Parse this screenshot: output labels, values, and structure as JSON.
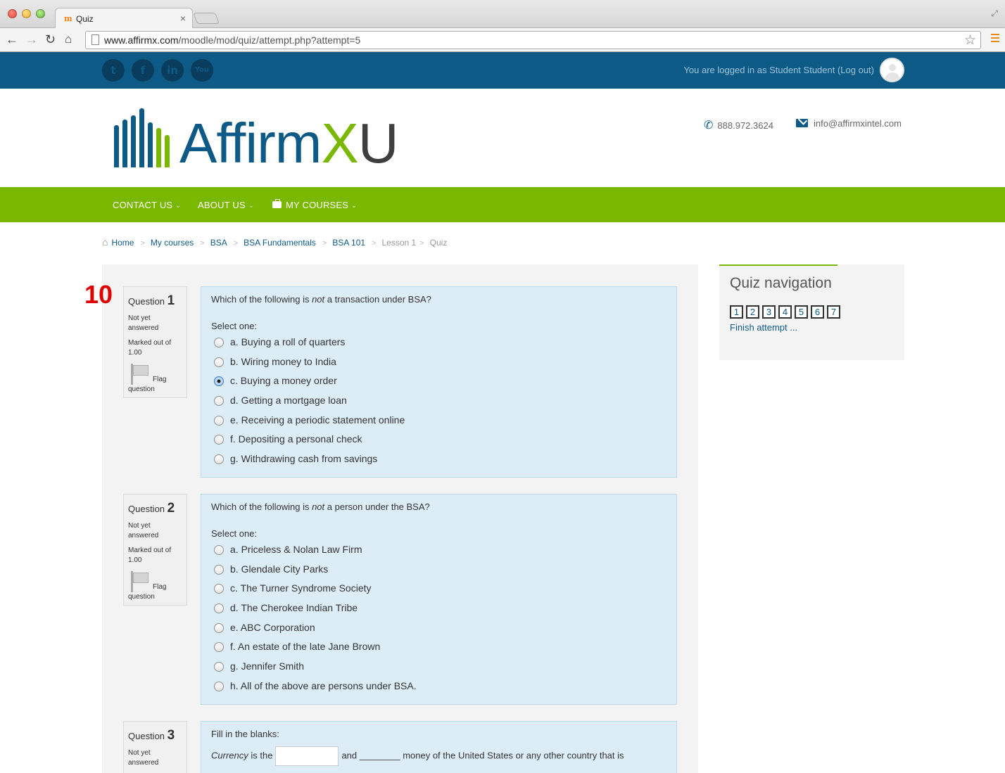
{
  "browser": {
    "tab_title": "Quiz",
    "tab_favicon": "m",
    "url_host": "www.affirmx.com",
    "url_path": "/moodle/mod/quiz/attempt.php?attempt=5"
  },
  "topbar": {
    "social_icons": [
      "twitter-icon",
      "facebook-icon",
      "linkedin-icon",
      "youtube-icon"
    ],
    "social_glyphs": [
      "t",
      "f",
      "in",
      "You"
    ],
    "login_text": "You are logged in as Student Student (Log out)"
  },
  "logo": {
    "part_affirm": "Affirm",
    "part_x": "X",
    "part_u": "U"
  },
  "contact": {
    "phone": "888.972.3624",
    "email": "info@affirmxintel.com"
  },
  "nav": {
    "contact_us": "CONTACT US",
    "about_us": "ABOUT US",
    "my_courses": "MY COURSES"
  },
  "breadcrumb": {
    "home": "Home",
    "my_courses": "My courses",
    "bsa": "BSA",
    "bsa_fundamentals": "BSA Fundamentals",
    "bsa_101": "BSA 101",
    "lesson": "Lesson 1",
    "quiz": "Quiz"
  },
  "page_number": "10",
  "questions": [
    {
      "label": "Question",
      "number": "1",
      "state_line1": "Not yet",
      "state_line2": "answered",
      "grade_line1": "Marked out of",
      "grade_line2": "1.00",
      "flag_line1": "Flag",
      "flag_line2": "question",
      "text_before": "Which of the following is ",
      "text_em": "not",
      "text_after": " a transaction under BSA?",
      "select_label": "Select one:",
      "options": [
        "a. Buying a roll of quarters",
        "b. Wiring money to India",
        "c. Buying a money order",
        "d. Getting a mortgage loan",
        "e. Receiving a periodic statement online",
        "f. Depositing a personal check",
        "g. Withdrawing cash from savings"
      ],
      "selected": "c. Buying a money order"
    },
    {
      "label": "Question",
      "number": "2",
      "state_line1": "Not yet",
      "state_line2": "answered",
      "grade_line1": "Marked out of",
      "grade_line2": "1.00",
      "flag_line1": "Flag",
      "flag_line2": "question",
      "text_before": "Which of the following is ",
      "text_em": "not",
      "text_after": " a person under the BSA?",
      "select_label": "Select one:",
      "options": [
        "a. Priceless & Nolan Law Firm",
        "b. Glendale City Parks",
        "c. The Turner Syndrome Society",
        "d. The Cherokee Indian Tribe",
        "e. ABC Corporation",
        "f. An estate of the late Jane Brown",
        "g. Jennifer Smith",
        "h. All of the above are persons under BSA."
      ],
      "selected": null
    },
    {
      "label": "Question",
      "number": "3",
      "state_line1": "Not yet",
      "state_line2": "answered",
      "text": "Fill in the blanks:",
      "blank_em": "Currency",
      "blank_part1": " is the",
      "blank_part2": "and ________ money of the United States or any other country that is"
    }
  ],
  "quiz_navigation": {
    "title": "Quiz navigation",
    "buttons": [
      "1",
      "2",
      "3",
      "4",
      "5",
      "6",
      "7"
    ],
    "finish": "Finish attempt ..."
  },
  "colors": {
    "brand_blue": "#0e5a86",
    "brand_green": "#7ab800",
    "question_bg": "#dcedf7",
    "page_number_red": "#e00000"
  }
}
